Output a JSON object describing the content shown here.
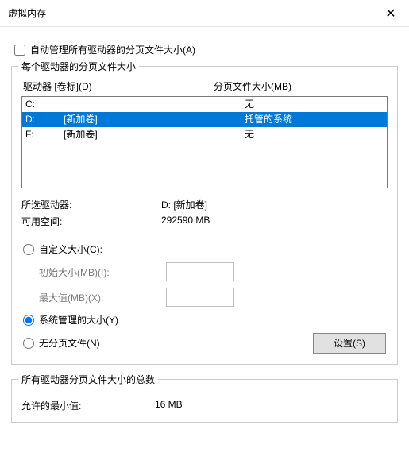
{
  "title": "虚拟内存",
  "auto_manage_label": "自动管理所有驱动器的分页文件大小(A)",
  "group1_title": "每个驱动器的分页文件大小",
  "col_drive": "驱动器 [卷标](D)",
  "col_pf": "分页文件大小(MB)",
  "drives": [
    {
      "letter": "C:",
      "volume": "",
      "pf": "无",
      "selected": false
    },
    {
      "letter": "D:",
      "volume": "[新加卷]",
      "pf": "托管的系统",
      "selected": true
    },
    {
      "letter": "F:",
      "volume": "[新加卷]",
      "pf": "无",
      "selected": false
    }
  ],
  "selected_drive_label": "所选驱动器:",
  "selected_drive_value": "D:  [新加卷]",
  "free_space_label": "可用空间:",
  "free_space_value": "292590 MB",
  "radio_custom": "自定义大小(C):",
  "initial_label": "初始大小(MB)(I):",
  "max_label": "最大值(MB)(X):",
  "radio_system": "系统管理的大小(Y)",
  "radio_none": "无分页文件(N)",
  "set_button": "设置(S)",
  "group2_title": "所有驱动器分页文件大小的总数",
  "min_allowed_label": "允许的最小值:",
  "min_allowed_value": "16 MB"
}
